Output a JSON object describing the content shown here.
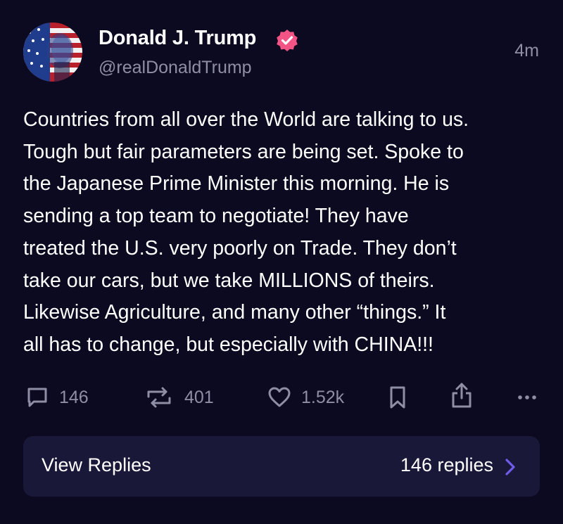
{
  "post": {
    "author": {
      "name": "Donald J. Trump",
      "handle": "@realDonaldTrump",
      "verified": true,
      "avatar_icon": "flag-portrait-avatar",
      "verified_icon": "verified-badge-icon"
    },
    "timestamp": "4m",
    "text": "Countries from all over the World are talking to us.\nTough but fair parameters are being set. Spoke to\nthe Japanese Prime Minister this morning. He is\nsending a top team to negotiate! They have\ntreated the U.S. very poorly on Trade. They don’t\ntake our cars, but we take MILLIONS of theirs.\nLikewise Agriculture, and many other “things.” It\nall has to change, but especially with CHINA!!!"
  },
  "actions": {
    "replies": {
      "icon": "comment-icon",
      "count": "146"
    },
    "reposts": {
      "icon": "repost-icon",
      "count": "401"
    },
    "likes": {
      "icon": "heart-icon",
      "count": "1.52k"
    },
    "bookmark": {
      "icon": "bookmark-icon"
    },
    "share": {
      "icon": "share-icon"
    },
    "more": {
      "icon": "more-options-icon"
    }
  },
  "replies_panel": {
    "label": "View Replies",
    "count_text": "146 replies",
    "icon": "chevron-right-icon"
  },
  "colors": {
    "background": "#0c0a20",
    "panel": "#1a1838",
    "text_primary": "#ffffff",
    "text_secondary": "#8e8ea6",
    "verified": "#f25585",
    "accent": "#6f5ce8"
  }
}
